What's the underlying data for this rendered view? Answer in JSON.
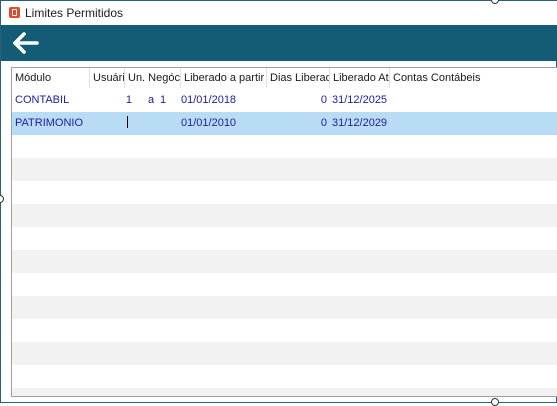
{
  "window": {
    "title": "Limites Permitidos"
  },
  "toolbar": {
    "back_icon": "arrow-left-icon"
  },
  "grid": {
    "columns": [
      "Módulo",
      "Usuário",
      "Un. Negócio",
      "Liberado a partir de",
      "Dias Liberados",
      "Liberado Até",
      "Contas Contábeis"
    ],
    "rows": [
      {
        "modulo": "CONTABIL",
        "usuario": "",
        "un_from": "1",
        "un_sep": "a",
        "un_to": "1",
        "liberado_de": "01/01/2018",
        "dias": "0",
        "liberado_ate": "31/12/2025",
        "contas": ""
      },
      {
        "modulo": "PATRIMONIO",
        "usuario": "",
        "un_from": "",
        "un_sep": "",
        "un_to": "",
        "liberado_de": "01/01/2010",
        "dias": "0",
        "liberado_ate": "31/12/2029",
        "contas": ""
      }
    ],
    "selected_row": 2
  },
  "colors": {
    "toolbar": "#145b76",
    "row_text": "#1d1f9a",
    "selected_row": "#b9dcf5",
    "alt_row": "#f2f2f2"
  }
}
